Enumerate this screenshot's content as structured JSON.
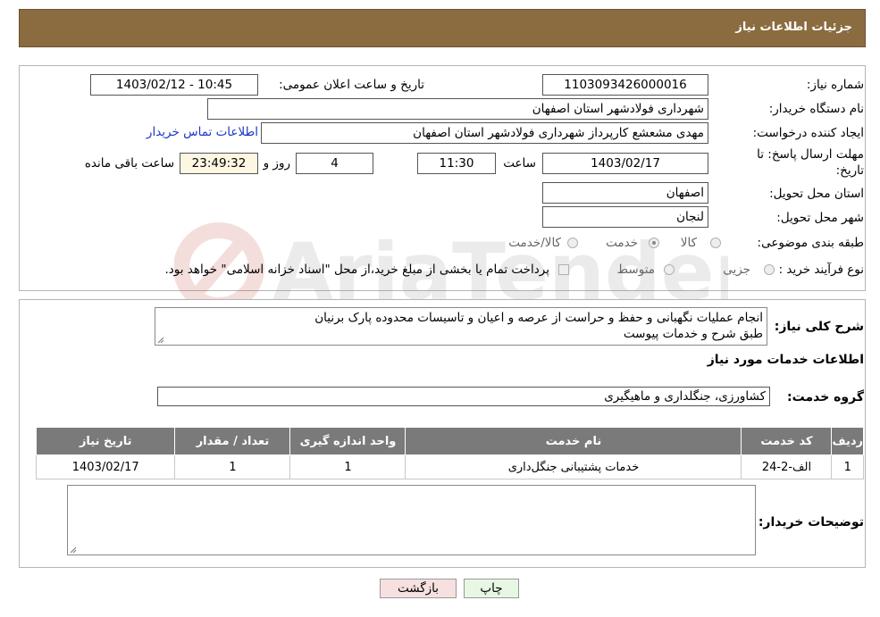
{
  "header": {
    "title": "جزئیات اطلاعات نیاز"
  },
  "form": {
    "need_number_label": "شماره نیاز:",
    "need_number": "1103093426000016",
    "announce_label": "تاریخ و ساعت اعلان عمومی:",
    "announce_value": "1403/02/12 - 10:45",
    "buyer_org_label": "نام دستگاه خریدار:",
    "buyer_org": "شهرداری فولادشهر استان اصفهان",
    "creator_label": "ایجاد کننده درخواست:",
    "creator": "مهدی مشعشع کارپرداز شهرداری فولادشهر استان اصفهان",
    "contact_link": "اطلاعات تماس خریدار",
    "deadline_label_1": "مهلت ارسال پاسخ: تا",
    "deadline_label_2": "تاریخ:",
    "deadline_date": "1403/02/17",
    "time_label": "ساعت",
    "deadline_time": "11:30",
    "days_value": "4",
    "days_label": "روز و",
    "remaining_time": "23:49:32",
    "remaining_label": "ساعت باقی مانده",
    "province_label": "استان محل تحویل:",
    "province": "اصفهان",
    "city_label": "شهر محل تحویل:",
    "city": "لنجان",
    "category_label": "طبقه بندی موضوعی:",
    "category_options": [
      "کالا",
      "خدمت",
      "کالا/خدمت"
    ],
    "category_selected": "خدمت",
    "process_label": "نوع فرآیند خرید :",
    "process_options": [
      "جزیی",
      "متوسط"
    ],
    "process_note": "پرداخت تمام یا بخشی از مبلغ خرید،از محل \"اسناد خزانه اسلامی\" خواهد بود."
  },
  "summary": {
    "label": "شرح کلی نیاز:",
    "text_line1": "انجام عملیات نگهبانی و حفظ و حراست از عرصه و اعیان و تاسیسات محدوده پارک برنیان",
    "text_line2": "طبق شرح و خدمات پیوست",
    "services_title": "اطلاعات خدمات مورد نیاز",
    "group_label": "گروه خدمت:",
    "group_value": "کشاورزی، جنگلداری و ماهیگیری"
  },
  "table": {
    "headers": [
      "ردیف",
      "کد خدمت",
      "نام خدمت",
      "واحد اندازه گیری",
      "تعداد / مقدار",
      "تاریخ نیاز"
    ],
    "rows": [
      [
        "1",
        "الف-2-24",
        "خدمات پشتیبانی جنگل‌داری",
        "1",
        "1",
        "1403/02/17"
      ]
    ]
  },
  "buyer_notes": {
    "label": "توضیحات خریدار:",
    "value": ""
  },
  "buttons": {
    "print": "چاپ",
    "back": "بازگشت"
  },
  "watermark": {
    "text": "AriaTender.neT"
  },
  "colors": {
    "header_bg": "#8b6c40",
    "table_header_bg": "#7a7a7a",
    "print_btn": "#e8f7e4",
    "back_btn": "#f7e0e0"
  }
}
